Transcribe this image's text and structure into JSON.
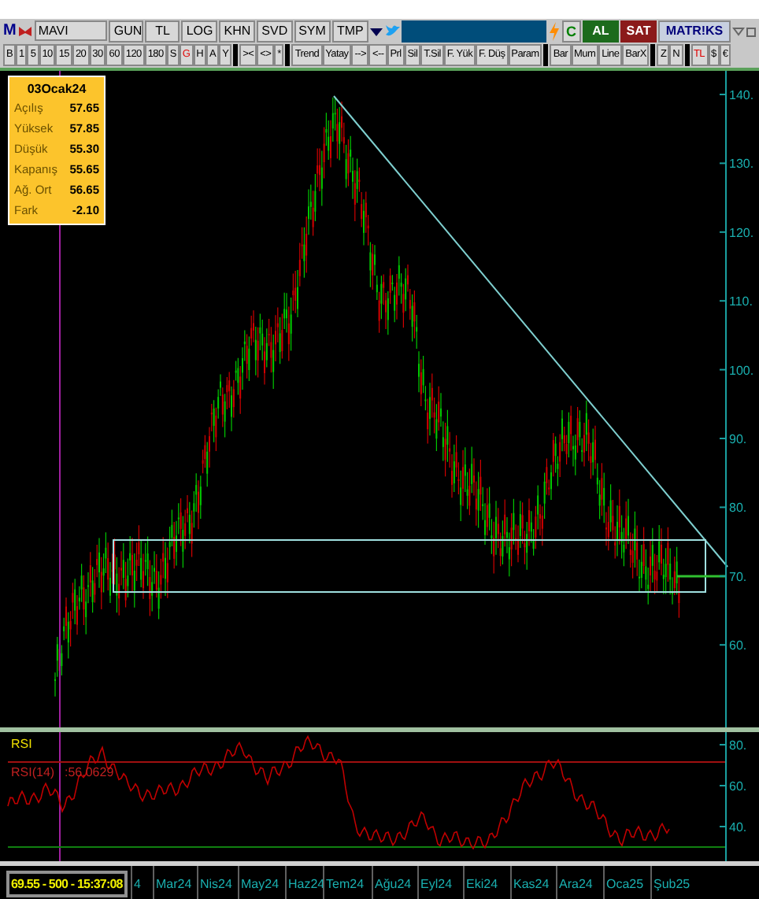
{
  "toolbar_top": {
    "logo_letter": "M",
    "account": "MAVI",
    "buttons": [
      "GUN",
      "TL",
      "LOG",
      "KHN",
      "SVD",
      "SYM",
      "TMP"
    ],
    "refresh": "C",
    "buy": "AL",
    "sell": "SAT",
    "brand": "MATR!KS"
  },
  "toolbar_bottom": [
    [
      {
        "label": "B",
        "accent": false
      },
      {
        "label": "1",
        "accent": false
      },
      {
        "label": "5",
        "accent": false
      },
      {
        "label": "10",
        "accent": false
      },
      {
        "label": "15",
        "accent": false
      },
      {
        "label": "20",
        "accent": false
      },
      {
        "label": "30",
        "accent": false
      },
      {
        "label": "60",
        "accent": false
      },
      {
        "label": "120",
        "accent": false
      },
      {
        "label": "180",
        "accent": false
      },
      {
        "label": "S",
        "accent": false
      },
      {
        "label": "G",
        "accent": true
      },
      {
        "label": "H",
        "accent": false
      },
      {
        "label": "A",
        "accent": false
      },
      {
        "label": "Y",
        "accent": false
      }
    ],
    [
      {
        "label": "><",
        "accent": false
      },
      {
        "label": "<>",
        "accent": false
      },
      {
        "label": "*",
        "accent": false
      }
    ],
    [
      {
        "label": "Trend",
        "accent": false
      },
      {
        "label": "Yatay",
        "accent": false
      },
      {
        "label": "-->",
        "accent": false
      },
      {
        "label": "<--",
        "accent": false
      },
      {
        "label": "Prl",
        "accent": false
      },
      {
        "label": "Sil",
        "accent": false
      },
      {
        "label": "T.Sil",
        "accent": false
      },
      {
        "label": "F. Yük",
        "accent": false
      },
      {
        "label": "F. Düş",
        "accent": false
      },
      {
        "label": "Param",
        "accent": false
      }
    ],
    [
      {
        "label": "Bar",
        "accent": false
      },
      {
        "label": "Mum",
        "accent": false
      },
      {
        "label": "Line",
        "accent": false
      },
      {
        "label": "BarX",
        "accent": false
      }
    ],
    [
      {
        "label": "Z",
        "accent": false
      },
      {
        "label": "N",
        "accent": false
      }
    ],
    [
      {
        "label": "TL",
        "accent": true
      },
      {
        "label": "$",
        "accent": false
      },
      {
        "label": "€",
        "accent": false
      }
    ]
  ],
  "info": {
    "date": "03Ocak24",
    "rows": [
      {
        "label": "Açılış",
        "value": "57.65"
      },
      {
        "label": "Yüksek",
        "value": "57.85"
      },
      {
        "label": "Düşük",
        "value": "55.30"
      },
      {
        "label": "Kapanış",
        "value": "55.65"
      },
      {
        "label": "Ağ. Ort",
        "value": "56.65"
      },
      {
        "label": "Fark",
        "value": "-2.10"
      }
    ]
  },
  "price_axis": [
    "140.",
    "130.",
    "120.",
    "110.",
    "100.",
    "90.",
    "80.",
    "70.",
    "60."
  ],
  "rsi": {
    "title": "RSI",
    "indicator": "RSI(14)",
    "value": ":56.0629",
    "axis": [
      "80.",
      "60.",
      "40."
    ]
  },
  "date_axis": [
    "4",
    "Mar24",
    "Nis24",
    "May24",
    "Haz24",
    "Tem24",
    "Ağu24",
    "Eyl24",
    "Eki24",
    "Kas24",
    "Ara24",
    "Oca25",
    "Şub25"
  ],
  "status": "69.55 - 500 - 15:37:08"
}
